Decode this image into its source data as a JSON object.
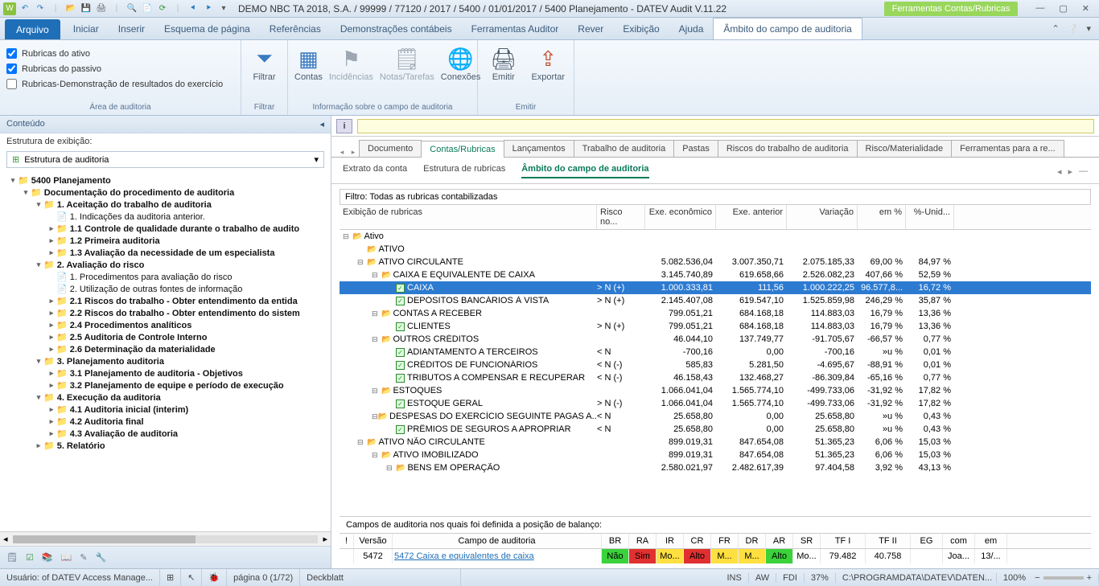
{
  "title": "DEMO NBC TA 2018, S.A. / 99999 / 77120 / 2017 / 5400 / 01/01/2017 / 5400 Planejamento - DATEV Audit V.11.22",
  "context_tab": "Ferramentas Contas/Rubricas",
  "menu": {
    "file": "Arquivo",
    "items": [
      "Iniciar",
      "Inserir",
      "Esquema de página",
      "Referências",
      "Demonstrações contábeis",
      "Ferramentas Auditor",
      "Rever",
      "Exibição",
      "Ajuda"
    ],
    "active": "Âmbito do campo de auditoria"
  },
  "ribbon": {
    "group1": {
      "label": "Área de auditoria",
      "checks": [
        "Rubricas do ativo",
        "Rubricas do passivo",
        "Rubricas-Demonstração de resultados do exercício"
      ]
    },
    "group2": {
      "label": "Filtrar",
      "btn": "Filtrar"
    },
    "group3": {
      "label": "Informação sobre o campo de auditoria",
      "btns": [
        "Contas",
        "Incidências",
        "Notas/Tarefas",
        "Conexões"
      ]
    },
    "group4": {
      "label": "Emitir",
      "btns": [
        "Emitir",
        "Exportar"
      ]
    }
  },
  "left": {
    "header": "Conteúdo",
    "sub": "Estrutura de exibição:",
    "select": "Estrutura de auditoria",
    "tree": [
      {
        "d": 0,
        "t": "v",
        "b": 1,
        "i": "f",
        "txt": "5400 Planejamento"
      },
      {
        "d": 1,
        "t": "v",
        "b": 1,
        "i": "f",
        "txt": "Documentação do procedimento de auditoria"
      },
      {
        "d": 2,
        "t": "v",
        "b": 1,
        "i": "f",
        "txt": "1. Aceitação do trabalho de auditoria"
      },
      {
        "d": 3,
        "t": "",
        "b": 0,
        "i": "d",
        "txt": "1. Indicações da auditoria anterior."
      },
      {
        "d": 3,
        "t": ">",
        "b": 1,
        "i": "f",
        "txt": "1.1 Controle de qualidade durante o trabalho de audito"
      },
      {
        "d": 3,
        "t": ">",
        "b": 1,
        "i": "f",
        "txt": "1.2 Primeira auditoria"
      },
      {
        "d": 3,
        "t": ">",
        "b": 1,
        "i": "f",
        "txt": "1.3 Avaliação da necessidade de um especialista"
      },
      {
        "d": 2,
        "t": "v",
        "b": 1,
        "i": "f",
        "txt": "2. Avaliação do risco"
      },
      {
        "d": 3,
        "t": "",
        "b": 0,
        "i": "d",
        "txt": "1. Procedimentos para avaliação do risco"
      },
      {
        "d": 3,
        "t": "",
        "b": 0,
        "i": "d",
        "txt": "2. Utilização de outras fontes de informação"
      },
      {
        "d": 3,
        "t": ">",
        "b": 1,
        "i": "f",
        "txt": "2.1 Riscos do trabalho - Obter entendimento da entida"
      },
      {
        "d": 3,
        "t": ">",
        "b": 1,
        "i": "f",
        "txt": "2.2 Riscos do trabalho - Obter entendimento do sistem"
      },
      {
        "d": 3,
        "t": ">",
        "b": 1,
        "i": "f",
        "txt": "2.4 Procedimentos analíticos"
      },
      {
        "d": 3,
        "t": ">",
        "b": 1,
        "i": "f",
        "txt": "2.5 Auditoria de Controle Interno"
      },
      {
        "d": 3,
        "t": ">",
        "b": 1,
        "i": "f",
        "txt": "2.6 Determinação da materialidade"
      },
      {
        "d": 2,
        "t": "v",
        "b": 1,
        "i": "f",
        "txt": "3. Planejamento auditoria"
      },
      {
        "d": 3,
        "t": ">",
        "b": 1,
        "i": "f",
        "txt": "3.1 Planejamento de auditoria - Objetivos"
      },
      {
        "d": 3,
        "t": ">",
        "b": 1,
        "i": "f",
        "txt": "3.2 Planejamento de equipe e período de execução"
      },
      {
        "d": 2,
        "t": "v",
        "b": 1,
        "i": "f",
        "txt": "4. Execução da auditoria"
      },
      {
        "d": 3,
        "t": ">",
        "b": 1,
        "i": "f",
        "txt": "4.1 Auditoria inicial (interim)"
      },
      {
        "d": 3,
        "t": ">",
        "b": 1,
        "i": "f",
        "txt": "4.2 Auditoria final"
      },
      {
        "d": 3,
        "t": ">",
        "b": 1,
        "i": "f",
        "txt": "4.3 Avaliação de auditoria"
      },
      {
        "d": 2,
        "t": ">",
        "b": 1,
        "i": "f",
        "txt": "5. Relatório"
      }
    ]
  },
  "tabs": [
    "Documento",
    "Contas/Rubricas",
    "Lançamentos",
    "Trabalho de auditoria",
    "Pastas",
    "Riscos do trabalho de auditoria",
    "Risco/Materialidade",
    "Ferramentas para a re..."
  ],
  "tabs_active": 1,
  "subtabs": [
    "Extrato da conta",
    "Estrutura de rubricas",
    "Âmbito do campo de auditoria"
  ],
  "subtabs_active": 2,
  "grid": {
    "filter": "Filtro: Todas as rubricas contabilizadas",
    "head_name": "Exibição de rubricas",
    "heads": [
      "Risco no...",
      "Exe. econômico",
      "Exe. anterior",
      "Variação",
      "em %",
      "%-Unid..."
    ],
    "rows": [
      {
        "d": 0,
        "t": "-",
        "i": "f",
        "name": "Ativo"
      },
      {
        "d": 1,
        "t": "",
        "i": "f",
        "name": "ATIVO"
      },
      {
        "d": 1,
        "t": "-",
        "i": "f",
        "name": "ATIVO CIRCULANTE",
        "v": [
          "",
          "5.082.536,04",
          "3.007.350,71",
          "2.075.185,33",
          "69,00 %",
          "84,97 %"
        ]
      },
      {
        "d": 2,
        "t": "-",
        "i": "f",
        "name": "CAIXA E EQUIVALENTE DE CAIXA",
        "v": [
          "",
          "3.145.740,89",
          "619.658,66",
          "2.526.082,23",
          "407,66 %",
          "52,59 %"
        ]
      },
      {
        "d": 3,
        "t": "",
        "i": "c",
        "sel": 1,
        "name": "CAIXA",
        "v": [
          "> N (+)",
          "1.000.333,81",
          "111,56",
          "1.000.222,25",
          "96.577,8...",
          "16,72 %"
        ]
      },
      {
        "d": 3,
        "t": "",
        "i": "c",
        "name": "DEPÓSITOS BANCÁRIOS À VISTA",
        "v": [
          "> N (+)",
          "2.145.407,08",
          "619.547,10",
          "1.525.859,98",
          "246,29 %",
          "35,87 %"
        ]
      },
      {
        "d": 2,
        "t": "-",
        "i": "f",
        "name": "CONTAS A RECEBER",
        "v": [
          "",
          "799.051,21",
          "684.168,18",
          "114.883,03",
          "16,79 %",
          "13,36 %"
        ]
      },
      {
        "d": 3,
        "t": "",
        "i": "c",
        "name": "CLIENTES",
        "v": [
          "> N (+)",
          "799.051,21",
          "684.168,18",
          "114.883,03",
          "16,79 %",
          "13,36 %"
        ]
      },
      {
        "d": 2,
        "t": "-",
        "i": "f",
        "name": "OUTROS CRÉDITOS",
        "v": [
          "",
          "46.044,10",
          "137.749,77",
          "-91.705,67",
          "-66,57 %",
          "0,77 %"
        ]
      },
      {
        "d": 3,
        "t": "",
        "i": "c",
        "name": "ADIANTAMENTO A TERCEIROS",
        "v": [
          "< N",
          "-700,16",
          "0,00",
          "-700,16",
          "»u %",
          "0,01 %"
        ]
      },
      {
        "d": 3,
        "t": "",
        "i": "c",
        "name": "CRÉDITOS DE FUNCIONÁRIOS",
        "v": [
          "< N (-)",
          "585,83",
          "5.281,50",
          "-4.695,67",
          "-88,91 %",
          "0,01 %"
        ]
      },
      {
        "d": 3,
        "t": "",
        "i": "c",
        "name": "TRIBUTOS A COMPENSAR E RECUPERAR",
        "v": [
          "< N (-)",
          "46.158,43",
          "132.468,27",
          "-86.309,84",
          "-65,16 %",
          "0,77 %"
        ]
      },
      {
        "d": 2,
        "t": "-",
        "i": "f",
        "name": "ESTOQUES",
        "v": [
          "",
          "1.066.041,04",
          "1.565.774,10",
          "-499.733,06",
          "-31,92 %",
          "17,82 %"
        ]
      },
      {
        "d": 3,
        "t": "",
        "i": "c",
        "name": "ESTOQUE GERAL",
        "v": [
          "> N (-)",
          "1.066.041,04",
          "1.565.774,10",
          "-499.733,06",
          "-31,92 %",
          "17,82 %"
        ]
      },
      {
        "d": 2,
        "t": "-",
        "i": "f",
        "name": "DESPESAS DO EXERCÍCIO SEGUINTE PAGAS A...",
        "v": [
          "< N",
          "25.658,80",
          "0,00",
          "25.658,80",
          "»u %",
          "0,43 %"
        ]
      },
      {
        "d": 3,
        "t": "",
        "i": "c",
        "name": "PRÊMIOS DE SEGUROS A APROPRIAR",
        "v": [
          "< N",
          "25.658,80",
          "0,00",
          "25.658,80",
          "»u %",
          "0,43 %"
        ]
      },
      {
        "d": 1,
        "t": "-",
        "i": "f",
        "name": "ATIVO NÃO CIRCULANTE",
        "v": [
          "",
          "899.019,31",
          "847.654,08",
          "51.365,23",
          "6,06 %",
          "15,03 %"
        ]
      },
      {
        "d": 2,
        "t": "-",
        "i": "f",
        "name": "ATIVO IMOBILIZADO",
        "v": [
          "",
          "899.019,31",
          "847.654,08",
          "51.365,23",
          "6,06 %",
          "15,03 %"
        ]
      },
      {
        "d": 3,
        "t": "-",
        "i": "f",
        "name": "BENS EM OPERAÇÃO",
        "v": [
          "",
          "2.580.021,97",
          "2.482.617,39",
          "97.404,58",
          "3,92 %",
          "43,13 %"
        ]
      }
    ]
  },
  "audit": {
    "caption": "Campos de auditoria nos quais foi definida a posição de balanço:",
    "heads": [
      "!",
      "Versão",
      "Campo de auditoria",
      "BR",
      "RA",
      "IR",
      "CR",
      "FR",
      "DR",
      "AR",
      "SR",
      "TF I",
      "TF II",
      "EG",
      "com",
      "em"
    ],
    "row": {
      "versao": "5472",
      "campo": "5472 Caixa e equivalentes de caixa",
      "cells": [
        {
          "t": "Não",
          "bg": "#3bd23b",
          "fg": "#000"
        },
        {
          "t": "Sim",
          "bg": "#e03030",
          "fg": "#000"
        },
        {
          "t": "Mo...",
          "bg": "#ffe040",
          "fg": "#000"
        },
        {
          "t": "Alto",
          "bg": "#e03030",
          "fg": "#000"
        },
        {
          "t": "M...",
          "bg": "#ffe040",
          "fg": "#000"
        },
        {
          "t": "M...",
          "bg": "#ffe040",
          "fg": "#000"
        },
        {
          "t": "Alto",
          "bg": "#3bd23b",
          "fg": "#000"
        },
        {
          "t": "Mo...",
          "bg": "",
          "fg": "#000"
        },
        {
          "t": "79.482",
          "bg": "",
          "fg": "#000"
        },
        {
          "t": "40.758",
          "bg": "",
          "fg": "#000"
        },
        {
          "t": "",
          "bg": "",
          "fg": "#000"
        },
        {
          "t": "Joa...",
          "bg": "",
          "fg": "#000"
        },
        {
          "t": "13/...",
          "bg": "",
          "fg": "#000"
        }
      ]
    }
  },
  "status": {
    "user": "Usuário: of DATEV Access Manage...",
    "page": "página 0 (1/72)",
    "doc": "Deckblatt",
    "ins": "INS",
    "aw": "AW",
    "fdi": "FDI",
    "pct": "37%",
    "path": "C:\\PROGRAMDATA\\DATEV\\DATEN...",
    "zoom": "100%"
  }
}
